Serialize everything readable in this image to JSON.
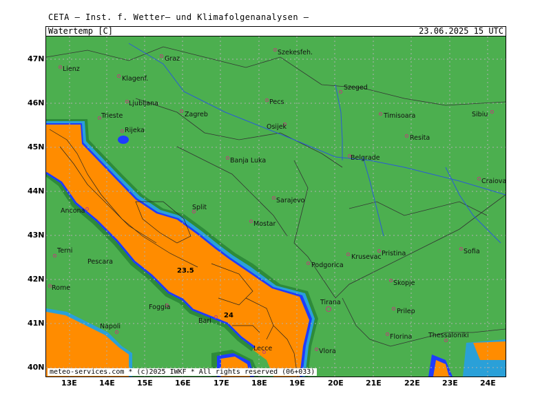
{
  "header": {
    "institute": "CETA — Inst. f. Wetter— und Klimafolgenanalysen —",
    "parameter": "Watertemp [C]",
    "datetime": "23.06.2025 15 UTC"
  },
  "map": {
    "credit": "meteo-services.com * (c)2025 IWKF * All rights reserved (06+033)",
    "latitudes": [
      "47N",
      "46N",
      "45N",
      "44N",
      "43N",
      "42N",
      "41N",
      "40N"
    ],
    "longitudes": [
      "13E",
      "14E",
      "15E",
      "16E",
      "17E",
      "18E",
      "19E",
      "20E",
      "21E",
      "22E",
      "23E",
      "24E"
    ],
    "contour_labels": [
      "23.5",
      "24"
    ],
    "cities": [
      {
        "name": "Lienz"
      },
      {
        "name": "Graz"
      },
      {
        "name": "Szekesfeh."
      },
      {
        "name": "Klagenf."
      },
      {
        "name": "Szeged"
      },
      {
        "name": "Ljubljana"
      },
      {
        "name": "Pecs"
      },
      {
        "name": "Zagreb"
      },
      {
        "name": "Timisoara"
      },
      {
        "name": "Sibiu"
      },
      {
        "name": "Trieste"
      },
      {
        "name": "Osijek"
      },
      {
        "name": "Rijeka"
      },
      {
        "name": "Resita"
      },
      {
        "name": "Belgrade"
      },
      {
        "name": "Banja Luka"
      },
      {
        "name": "Craiova"
      },
      {
        "name": "Sarajevo"
      },
      {
        "name": "Ancona"
      },
      {
        "name": "Split"
      },
      {
        "name": "Mostar"
      },
      {
        "name": "Terni"
      },
      {
        "name": "Pristina"
      },
      {
        "name": "Sofia"
      },
      {
        "name": "Krusevac"
      },
      {
        "name": "Podgorica"
      },
      {
        "name": "Pescara"
      },
      {
        "name": "Skopje"
      },
      {
        "name": "Rome"
      },
      {
        "name": "Tirana"
      },
      {
        "name": "Foggia"
      },
      {
        "name": "Prilep"
      },
      {
        "name": "Bari"
      },
      {
        "name": "Napoli"
      },
      {
        "name": "Florina"
      },
      {
        "name": "Thessaloniki"
      },
      {
        "name": "Lecce"
      },
      {
        "name": "Vlora"
      }
    ]
  },
  "colors": {
    "land": "#4caf4f",
    "sea_warm": "#ff8c00",
    "sea_warmer": "#ff9f1a",
    "coast_blue": "#1e3cff",
    "coast_cyan": "#2aa0d8",
    "grid": "#b0b0b0"
  }
}
